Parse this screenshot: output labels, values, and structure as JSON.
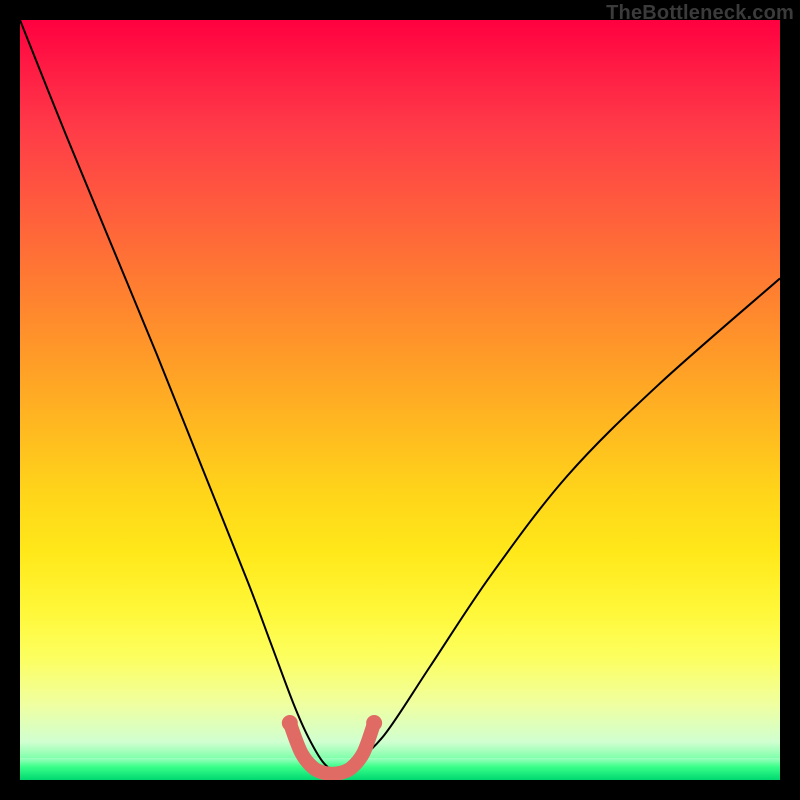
{
  "watermark": "TheBottleneck.com",
  "chart_data": {
    "type": "line",
    "title": "",
    "xlabel": "",
    "ylabel": "",
    "xlim": [
      0,
      100
    ],
    "ylim": [
      0,
      100
    ],
    "grid": false,
    "legend": false,
    "series": [
      {
        "name": "bottleneck-curve",
        "color": "#000000",
        "x": [
          0,
          6,
          12,
          18,
          24,
          30,
          33,
          36,
          38,
          40,
          42,
          44,
          48,
          54,
          62,
          72,
          84,
          100
        ],
        "y": [
          100,
          85,
          70.5,
          56,
          41,
          26,
          18,
          10,
          5.5,
          2.2,
          1.0,
          2.2,
          6,
          15,
          27,
          40,
          52,
          66
        ]
      },
      {
        "name": "valley-highlight",
        "color": "#e06a64",
        "x": [
          35.5,
          37,
          38.6,
          40.2,
          42,
          43.6,
          45.2,
          46.6
        ],
        "y": [
          7.5,
          3.6,
          1.6,
          0.9,
          0.9,
          1.6,
          3.6,
          7.5
        ]
      }
    ],
    "highlight_endpoints": {
      "left": {
        "x": 35.5,
        "y": 7.5
      },
      "right": {
        "x": 46.6,
        "y": 7.5
      }
    },
    "background": {
      "type": "vertical-gradient",
      "stops": [
        {
          "pos": 0.0,
          "color": "#ff0040"
        },
        {
          "pos": 0.5,
          "color": "#ffba20"
        },
        {
          "pos": 0.8,
          "color": "#fff83a"
        },
        {
          "pos": 0.95,
          "color": "#d0ffd0"
        },
        {
          "pos": 1.0,
          "color": "#00e070"
        }
      ]
    }
  }
}
